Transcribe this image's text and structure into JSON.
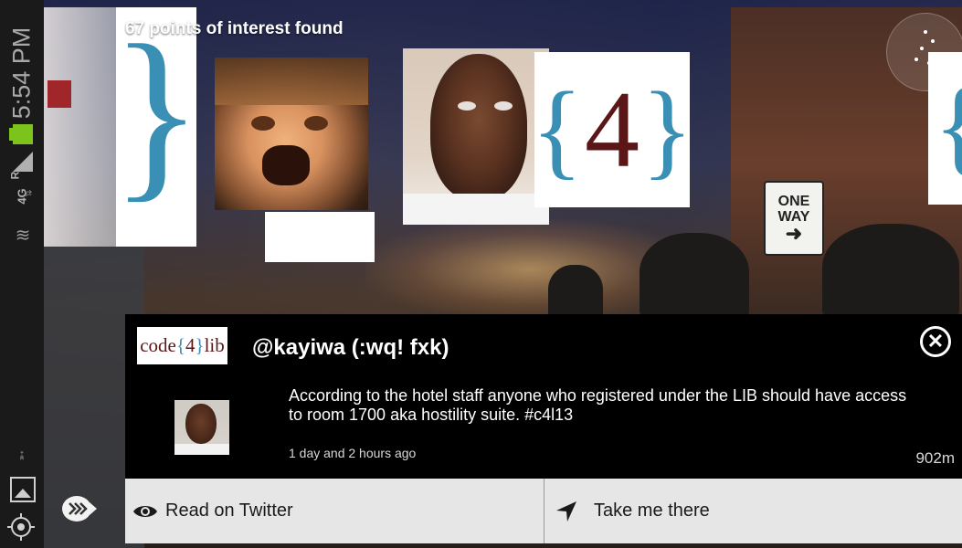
{
  "status_bar": {
    "time": "5:54 PM",
    "network": "4G",
    "signal_label": "R",
    "battery_color": "#7cc31c",
    "icons": [
      "signal-icon",
      "battery-icon",
      "network-icon",
      "data-activity-icon",
      "usb-icon"
    ]
  },
  "sidebar": {
    "icons": [
      "photo-icon",
      "locate-icon",
      "view-toggle-icon"
    ]
  },
  "ar_view": {
    "poi_count_text": "67 points of interest found",
    "sign_line1": "ONE",
    "sign_line2": "WAY",
    "logo_brace_open": "{",
    "logo_brace_close": "}",
    "logo_number": "4",
    "edge_brace": "{",
    "left_brace": "}"
  },
  "detail_panel": {
    "logo_code": "code",
    "logo_brace_open": "{",
    "logo_num": "4",
    "logo_brace_close": "}",
    "logo_lib": "lib",
    "title": "@kayiwa (:wq! fxk)",
    "tweet_text": "According to the hotel staff anyone who registered under the LIB should have access to room 1700 aka hostility suite. #c4l13",
    "timestamp": "1 day and 2 hours ago",
    "distance": "902m",
    "close_icon": "close-icon"
  },
  "actions": {
    "read_label": "Read on Twitter",
    "take_label": "Take me there",
    "read_icon": "eye-icon",
    "take_icon": "navigation-arrow-icon"
  },
  "colors": {
    "brand_blue": "#3a8fb4",
    "brand_maroon": "#5b1718",
    "panel_bg": "#000000",
    "action_bg": "#e6e6e6"
  }
}
